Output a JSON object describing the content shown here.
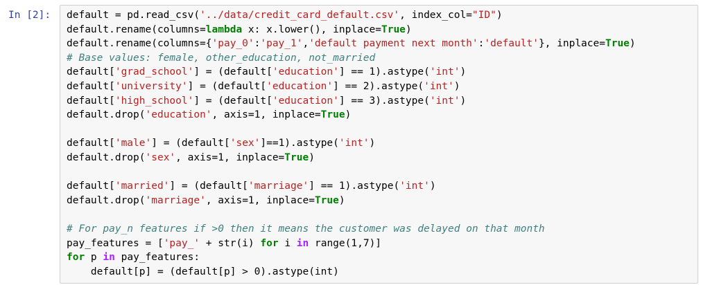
{
  "cell": {
    "prompt": "In [2]:",
    "lines": [
      [
        {
          "t": "default = pd.read_csv(",
          "c": "plain"
        },
        {
          "t": "'../data/credit_card_default.csv'",
          "c": "str"
        },
        {
          "t": ", index_col=",
          "c": "plain"
        },
        {
          "t": "\"ID\"",
          "c": "str"
        },
        {
          "t": ")",
          "c": "plain"
        }
      ],
      [
        {
          "t": "default.rename(columns=",
          "c": "plain"
        },
        {
          "t": "lambda",
          "c": "kw"
        },
        {
          "t": " x: x.lower(), inplace=",
          "c": "plain"
        },
        {
          "t": "True",
          "c": "bool"
        },
        {
          "t": ")",
          "c": "plain"
        }
      ],
      [
        {
          "t": "default.rename(columns={",
          "c": "plain"
        },
        {
          "t": "'pay_0'",
          "c": "str"
        },
        {
          "t": ":",
          "c": "plain"
        },
        {
          "t": "'pay_1'",
          "c": "str"
        },
        {
          "t": ",",
          "c": "plain"
        },
        {
          "t": "'default payment next month'",
          "c": "str"
        },
        {
          "t": ":",
          "c": "plain"
        },
        {
          "t": "'default'",
          "c": "str"
        },
        {
          "t": "}, inplace=",
          "c": "plain"
        },
        {
          "t": "True",
          "c": "bool"
        },
        {
          "t": ")",
          "c": "plain"
        }
      ],
      [
        {
          "t": "# Base values: female, other_education, not_married",
          "c": "cmt"
        }
      ],
      [
        {
          "t": "default[",
          "c": "plain"
        },
        {
          "t": "'grad_school'",
          "c": "str"
        },
        {
          "t": "] = (default[",
          "c": "plain"
        },
        {
          "t": "'education'",
          "c": "str"
        },
        {
          "t": "] == 1).astype(",
          "c": "plain"
        },
        {
          "t": "'int'",
          "c": "str"
        },
        {
          "t": ")",
          "c": "plain"
        }
      ],
      [
        {
          "t": "default[",
          "c": "plain"
        },
        {
          "t": "'university'",
          "c": "str"
        },
        {
          "t": "] = (default[",
          "c": "plain"
        },
        {
          "t": "'education'",
          "c": "str"
        },
        {
          "t": "] == 2).astype(",
          "c": "plain"
        },
        {
          "t": "'int'",
          "c": "str"
        },
        {
          "t": ")",
          "c": "plain"
        }
      ],
      [
        {
          "t": "default[",
          "c": "plain"
        },
        {
          "t": "'high_school'",
          "c": "str"
        },
        {
          "t": "] = (default[",
          "c": "plain"
        },
        {
          "t": "'education'",
          "c": "str"
        },
        {
          "t": "] == 3).astype(",
          "c": "plain"
        },
        {
          "t": "'int'",
          "c": "str"
        },
        {
          "t": ")",
          "c": "plain"
        }
      ],
      [
        {
          "t": "default.drop(",
          "c": "plain"
        },
        {
          "t": "'education'",
          "c": "str"
        },
        {
          "t": ", axis=1, inplace=",
          "c": "plain"
        },
        {
          "t": "True",
          "c": "bool"
        },
        {
          "t": ")",
          "c": "plain"
        }
      ],
      [],
      [
        {
          "t": "default[",
          "c": "plain"
        },
        {
          "t": "'male'",
          "c": "str"
        },
        {
          "t": "] = (default[",
          "c": "plain"
        },
        {
          "t": "'sex'",
          "c": "str"
        },
        {
          "t": "]==1).astype(",
          "c": "plain"
        },
        {
          "t": "'int'",
          "c": "str"
        },
        {
          "t": ")",
          "c": "plain"
        }
      ],
      [
        {
          "t": "default.drop(",
          "c": "plain"
        },
        {
          "t": "'sex'",
          "c": "str"
        },
        {
          "t": ", axis=1, inplace=",
          "c": "plain"
        },
        {
          "t": "True",
          "c": "bool"
        },
        {
          "t": ")",
          "c": "plain"
        }
      ],
      [],
      [
        {
          "t": "default[",
          "c": "plain"
        },
        {
          "t": "'married'",
          "c": "str"
        },
        {
          "t": "] = (default[",
          "c": "plain"
        },
        {
          "t": "'marriage'",
          "c": "str"
        },
        {
          "t": "] == 1).astype(",
          "c": "plain"
        },
        {
          "t": "'int'",
          "c": "str"
        },
        {
          "t": ")",
          "c": "plain"
        }
      ],
      [
        {
          "t": "default.drop(",
          "c": "plain"
        },
        {
          "t": "'marriage'",
          "c": "str"
        },
        {
          "t": ", axis=1, inplace=",
          "c": "plain"
        },
        {
          "t": "True",
          "c": "bool"
        },
        {
          "t": ")",
          "c": "plain"
        }
      ],
      [],
      [
        {
          "t": "# For pay_n features if >0 then it means the customer was delayed on that month",
          "c": "cmt"
        }
      ],
      [
        {
          "t": "pay_features = [",
          "c": "plain"
        },
        {
          "t": "'pay_'",
          "c": "str"
        },
        {
          "t": " + str(i) ",
          "c": "plain"
        },
        {
          "t": "for",
          "c": "kw"
        },
        {
          "t": " i ",
          "c": "plain"
        },
        {
          "t": "in",
          "c": "op"
        },
        {
          "t": " range(1,7)]",
          "c": "plain"
        }
      ],
      [
        {
          "t": "for",
          "c": "kw"
        },
        {
          "t": " p ",
          "c": "plain"
        },
        {
          "t": "in",
          "c": "op"
        },
        {
          "t": " pay_features:",
          "c": "plain"
        }
      ],
      [
        {
          "t": "    default[p] = (default[p] > 0).astype(int)",
          "c": "plain"
        }
      ]
    ]
  },
  "colors": {
    "prompt": "#303f9f",
    "cell_background": "#f7f7f7",
    "cell_border": "#cfcfcf",
    "keyword": "#008000",
    "string": "#ba2121",
    "comment": "#408080"
  }
}
